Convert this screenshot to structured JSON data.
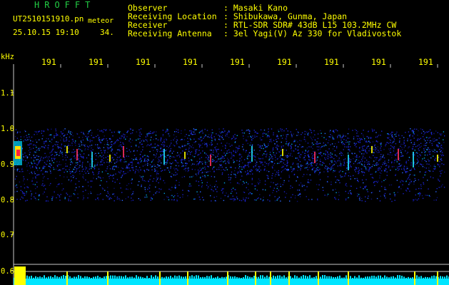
{
  "header": {
    "app_title": "HROFFT",
    "file_name": "UT2510151910.pn",
    "file_label": "meteor",
    "timestamp": "25.10.15 19:10",
    "minute_count": "34."
  },
  "station_info": [
    {
      "label": "Observer",
      "value": ": Masaki Kano"
    },
    {
      "label": "Receiving Location",
      "value": ": Shibukawa, Gunma, Japan"
    },
    {
      "label": "Receiver",
      "value": ": RTL-SDR SDR# 43dB L15 103.2MHz CW"
    },
    {
      "label": "Receiving Antenna",
      "value": ": 3el Yagi(V) Az 330 for Vladivostok"
    }
  ],
  "y_axis": {
    "unit": "kHz",
    "ticks": [
      "1.1",
      "1.0",
      "0.9",
      "0.8",
      "0.7",
      "0.6"
    ]
  },
  "x_axis": {
    "ticks": [
      "191",
      "191",
      "191",
      "191",
      "191",
      "191",
      "191",
      "191",
      "191",
      "1920"
    ]
  },
  "colors": {
    "background": "#000000",
    "text_yellow": "#ffff00",
    "title_green": "#22cc44",
    "grid": "#c8c8c8",
    "noise_blue": "#1a22c8",
    "level_cyan": "#00e5ff"
  }
}
